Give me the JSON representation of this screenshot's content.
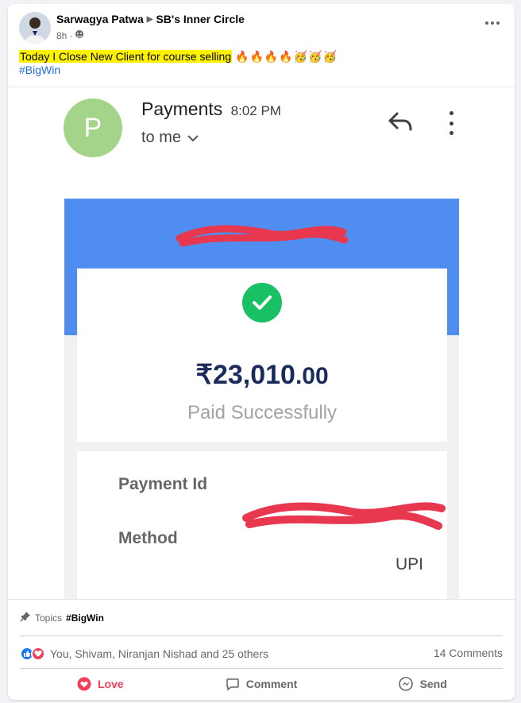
{
  "post": {
    "author": "Sarwagya Patwa",
    "group": "SB's Inner Circle",
    "time": "8h",
    "text_highlight": "Today I Close New Client for course selling",
    "text_emojis": "🔥🔥🔥🔥🥳🥳🥳",
    "hashtag": "#BigWin"
  },
  "photo": {
    "email_avatar_letter": "P",
    "email_sender": "Payments",
    "email_time": "8:02 PM",
    "email_to": "to me",
    "amount_main": "₹23,010",
    "amount_decimal": ".00",
    "status": "Paid Successfully",
    "payment_id_label": "Payment Id",
    "method_label": "Method",
    "method_value": "UPI"
  },
  "topics": {
    "label": "Topics",
    "tag": "#BigWin"
  },
  "engagement": {
    "reactions_text": "You, Shivam, Niranjan Nishad and 25 others",
    "comments_text": "14 Comments"
  },
  "actions": {
    "love": "Love",
    "comment": "Comment",
    "send": "Send"
  },
  "colors": {
    "love_red": "#f33e58",
    "link_blue": "#216fdb",
    "highlight_yellow": "#fff200",
    "success_green": "#17c164",
    "banner_blue": "#4f8ef0"
  }
}
